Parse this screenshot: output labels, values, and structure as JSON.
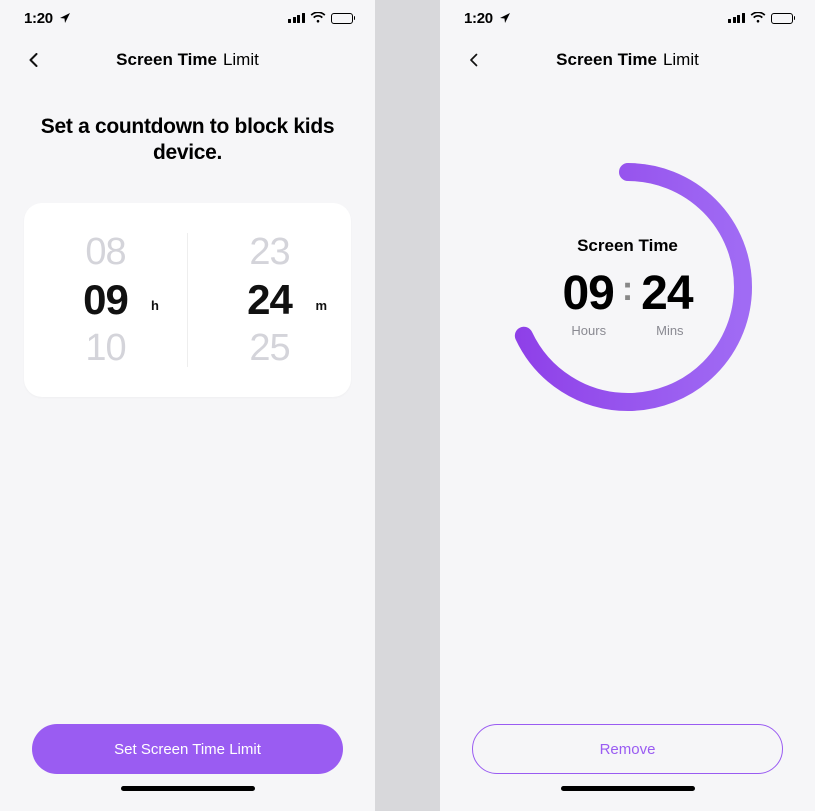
{
  "status": {
    "time": "1:20"
  },
  "left": {
    "nav": {
      "bold": "Screen Time",
      "light": "Limit"
    },
    "headline": "Set a countdown to block kids device.",
    "picker": {
      "hours": {
        "prev": "08",
        "current": "09",
        "next": "10",
        "unit": "h"
      },
      "mins": {
        "prev": "23",
        "current": "24",
        "next": "25",
        "unit": "m"
      }
    },
    "cta": "Set Screen Time Limit"
  },
  "right": {
    "nav": {
      "bold": "Screen Time",
      "light": "Limit"
    },
    "gauge": {
      "label": "Screen Time",
      "hours": "09",
      "mins": "24",
      "colon": ":",
      "hoursLabel": "Hours",
      "minsLabel": "Mins",
      "percent": 0.68
    },
    "cta": "Remove"
  }
}
